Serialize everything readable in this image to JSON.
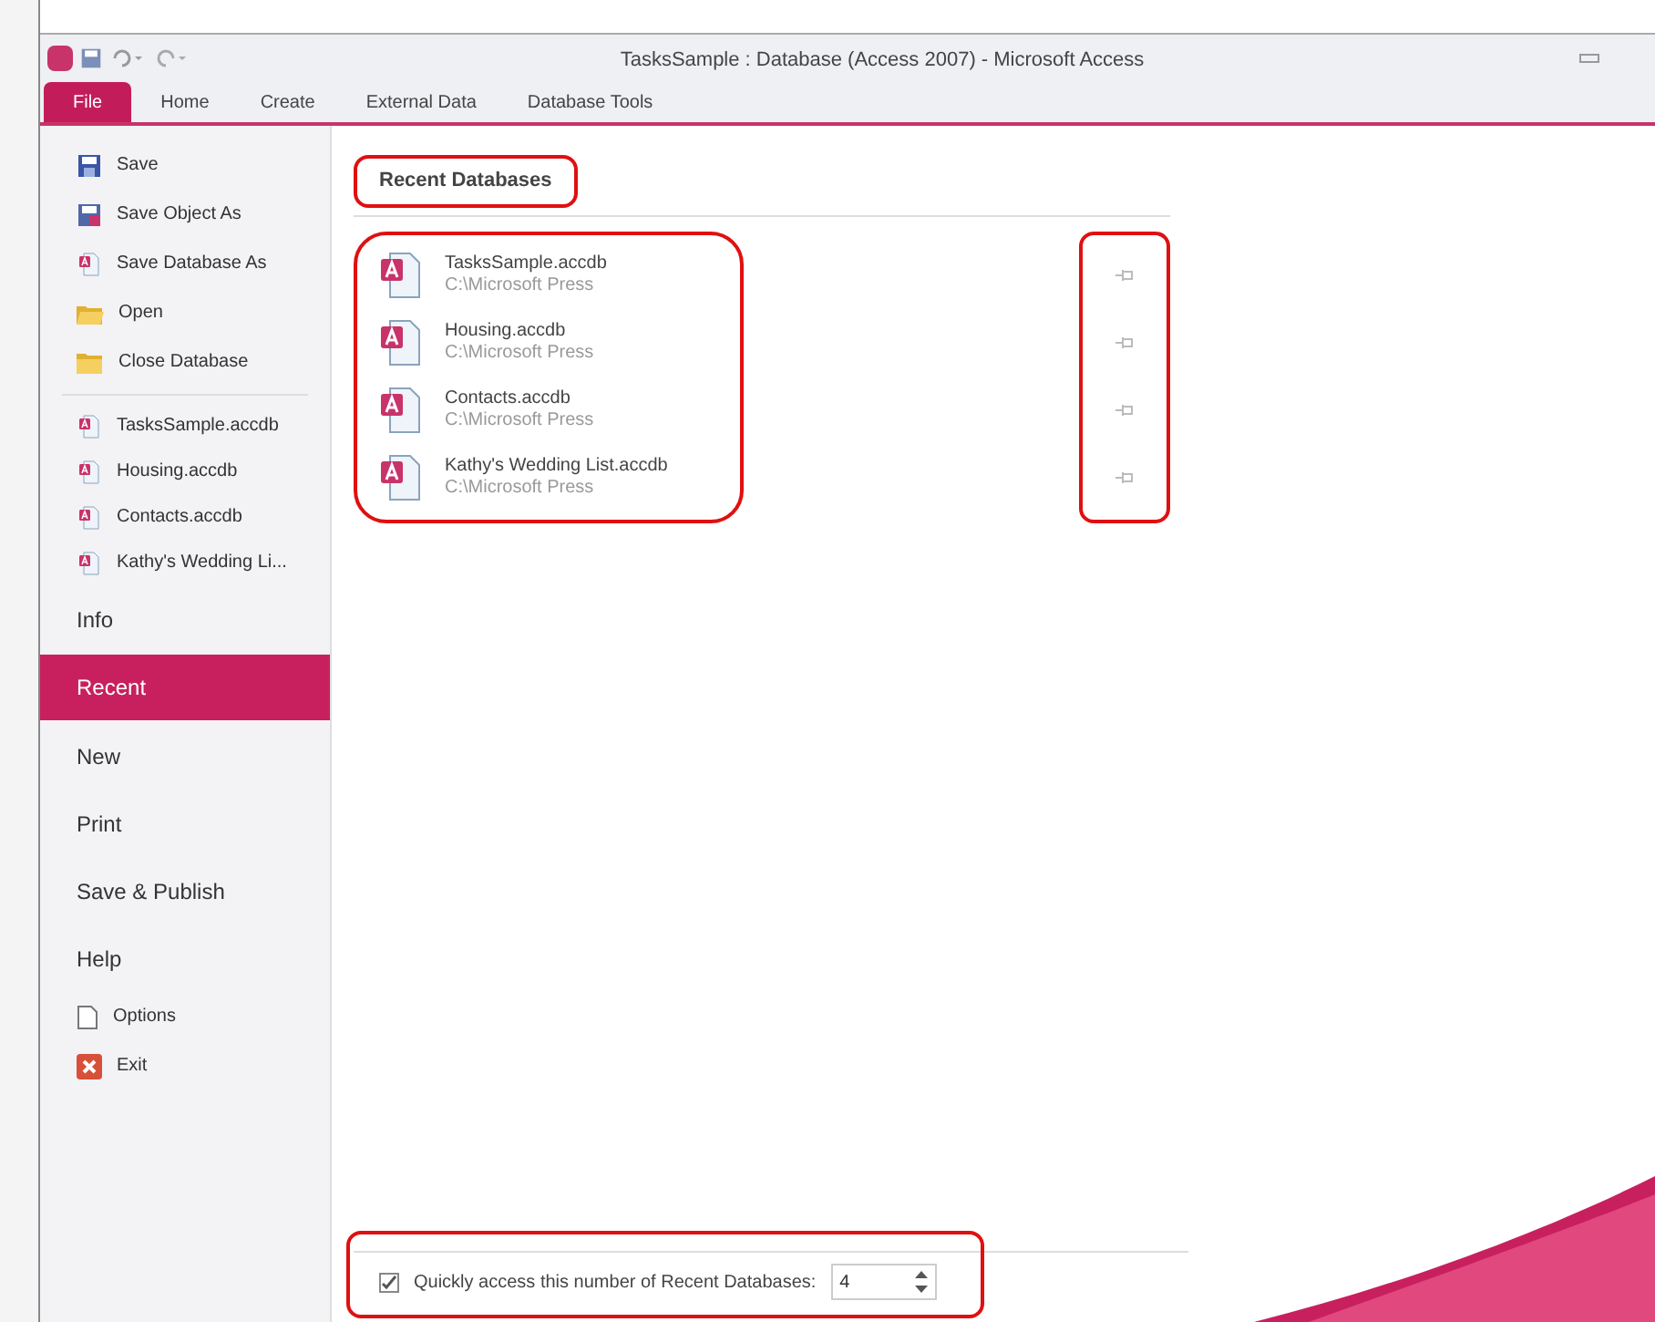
{
  "window": {
    "title": "TasksSample : Database (Access 2007)  -  Microsoft Access"
  },
  "ribbon_tabs": [
    {
      "label": "File",
      "selected": true
    },
    {
      "label": "Home",
      "selected": false
    },
    {
      "label": "Create",
      "selected": false
    },
    {
      "label": "External Data",
      "selected": false
    },
    {
      "label": "Database Tools",
      "selected": false
    }
  ],
  "sidebar": {
    "commands": [
      {
        "label": "Save",
        "kind": "save"
      },
      {
        "label": "Save Object As",
        "kind": "save-as"
      },
      {
        "label": "Save Database As",
        "kind": "database"
      },
      {
        "label": "Open",
        "kind": "open"
      },
      {
        "label": "Close Database",
        "kind": "close"
      }
    ],
    "recent_files": [
      "TasksSample.accdb",
      "Housing.accdb",
      "Contacts.accdb",
      "Kathy's Wedding Li..."
    ],
    "nav": [
      {
        "label": "Info",
        "selected": false
      },
      {
        "label": "Recent",
        "selected": true
      },
      {
        "label": "New",
        "selected": false
      },
      {
        "label": "Print",
        "selected": false
      },
      {
        "label": "Save & Publish",
        "selected": false
      },
      {
        "label": "Help",
        "selected": false
      }
    ],
    "bottom": [
      {
        "label": "Options",
        "kind": "options"
      },
      {
        "label": "Exit",
        "kind": "exit"
      }
    ]
  },
  "recent": {
    "heading": "Recent Databases",
    "heading_highlighted": true,
    "list_highlighted": true,
    "pins_highlighted": true,
    "files": [
      {
        "name": "TasksSample.accdb",
        "path": "C:\\Microsoft Press"
      },
      {
        "name": "Housing.accdb",
        "path": "C:\\Microsoft Press"
      },
      {
        "name": "Contacts.accdb",
        "path": "C:\\Microsoft Press"
      },
      {
        "name": "Kathy's Wedding List.accdb",
        "path": "C:\\Microsoft Press"
      }
    ]
  },
  "quick_access": {
    "label": "Quickly access this number of Recent Databases:",
    "checked": true,
    "value": "4",
    "highlighted": true
  }
}
